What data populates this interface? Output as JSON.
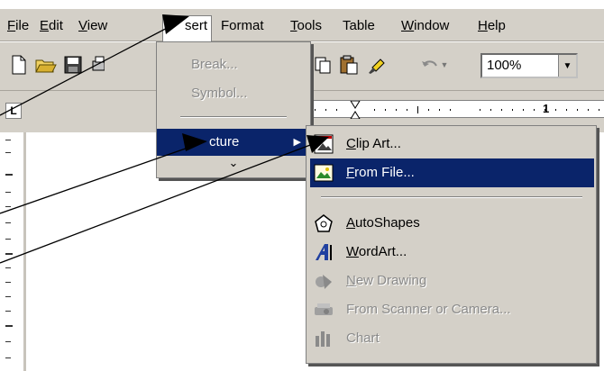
{
  "menubar": {
    "items": [
      {
        "key": "F",
        "rest": "ile"
      },
      {
        "key": "E",
        "rest": "dit"
      },
      {
        "key": "V",
        "rest": "iew"
      },
      {
        "key": "",
        "rest": "sert"
      },
      {
        "key": "",
        "rest": "Format"
      },
      {
        "key": "T",
        "rest": "ools"
      },
      {
        "key": "",
        "rest": "Table"
      },
      {
        "key": "W",
        "rest": "indow"
      },
      {
        "key": "H",
        "rest": "elp"
      }
    ]
  },
  "toolbar": {
    "zoom": "100%"
  },
  "ruler": {
    "mark": "1"
  },
  "insert_menu": {
    "break": "Break...",
    "symbol": "Symbol...",
    "picture": "cture",
    "expand": "⌄"
  },
  "picture_submenu": {
    "clip_art": {
      "key": "C",
      "rest": "lip Art..."
    },
    "from_file": {
      "key": "F",
      "rest": "rom File..."
    },
    "autoshapes": {
      "key": "A",
      "rest": "utoShapes"
    },
    "wordart": {
      "key": "W",
      "rest": "ordArt..."
    },
    "new_drawing": {
      "key": "N",
      "rest": "ew Drawing"
    },
    "from_scanner": "From Scanner or Camera...",
    "chart": "Chart"
  },
  "colors": {
    "menu_bg": "#d4d0c8",
    "highlight": "#0a246a",
    "disabled": "#8a8a8a"
  }
}
